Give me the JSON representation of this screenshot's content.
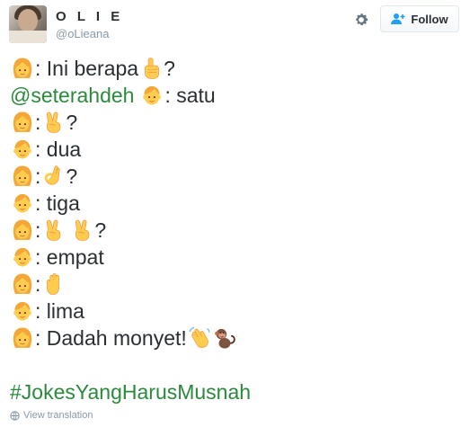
{
  "user": {
    "display_name": "O L I E",
    "handle": "@oLieana"
  },
  "header": {
    "follow_label": "Follow"
  },
  "tweet": {
    "lines": [
      {
        "t1": ": Ini berapa",
        "t2": "?"
      },
      {
        "mention": "@seterahdeh",
        "t2": " : satu"
      },
      {
        "t1": ": ",
        "t2": "?"
      },
      {
        "t1": ": dua"
      },
      {
        "t1": ": ",
        "t2": "?"
      },
      {
        "t1": ": tiga"
      },
      {
        "t1": ": ",
        "t2": "?"
      },
      {
        "t1": ": empat"
      },
      {
        "t1": ": "
      },
      {
        "t1": ": lima"
      },
      {
        "t1": ": Dadah monyet! "
      }
    ],
    "hashtag": "#JokesYangHarusMusnah"
  },
  "footer": {
    "view_translation": "View translation"
  },
  "icons": {
    "girl": "girl-emoji-icon",
    "boy": "boy-emoji-icon",
    "pointing_up": "pointing-up-emoji-icon",
    "victory": "victory-hand-emoji-icon",
    "ok_hand": "ok-hand-emoji-icon",
    "raised_hand": "raised-hand-emoji-icon",
    "waving": "waving-hands-emoji-icon",
    "monkey": "monkey-emoji-icon"
  },
  "colors": {
    "text": "#292f33",
    "muted": "#8899a6",
    "link": "#2a8a3c",
    "follow_icon": "#1da1f2"
  }
}
